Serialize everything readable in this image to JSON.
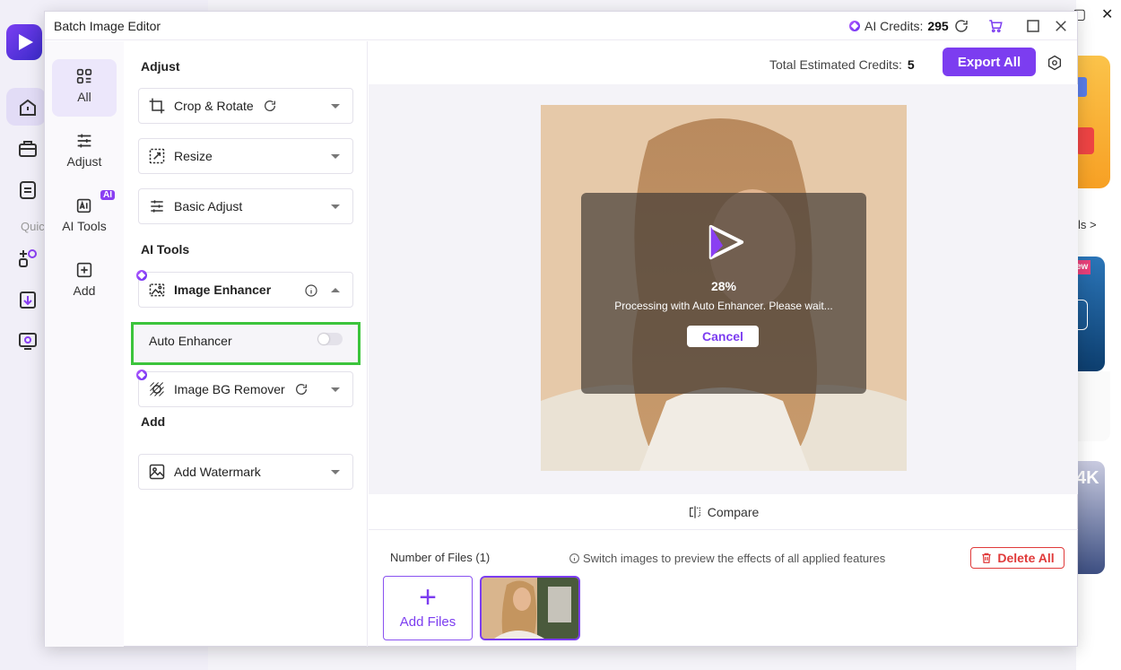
{
  "background": {
    "rail_quick_label": "Quic",
    "right_text": "ls >",
    "right_badge": "ew",
    "right_4k": "4K"
  },
  "dialog": {
    "title": "Batch Image Editor",
    "ai_credits_label": "AI Credits:",
    "ai_credits_value": "295",
    "icons": [
      "refresh-icon",
      "cart-icon",
      "maximize-icon",
      "close-icon"
    ]
  },
  "rail": {
    "items": [
      {
        "label": "All",
        "icon": "grid-icon",
        "active": true
      },
      {
        "label": "Adjust",
        "icon": "sliders-icon",
        "active": false
      },
      {
        "label": "AI Tools",
        "icon": "ai-icon",
        "active": false,
        "badge": "AI"
      },
      {
        "label": "Add",
        "icon": "plus-square-icon",
        "active": false
      }
    ]
  },
  "panel": {
    "adjust_title": "Adjust",
    "crop_rotate": "Crop & Rotate",
    "resize": "Resize",
    "basic_adjust": "Basic Adjust",
    "ai_tools_title": "AI Tools",
    "image_enhancer": "Image Enhancer",
    "auto_enhancer": "Auto Enhancer",
    "auto_enhancer_on": false,
    "bg_remover": "Image BG Remover",
    "add_title": "Add",
    "add_watermark": "Add Watermark"
  },
  "main": {
    "estimated_label": "Total Estimated Credits:",
    "estimated_value": "5",
    "export_label": "Export All",
    "progress_percent": "28%",
    "processing_message": "Processing with Auto Enhancer. Please wait...",
    "cancel_label": "Cancel",
    "compare_label": "Compare",
    "files_count": "Number of Files (1)",
    "hint": "Switch images to preview the effects of all applied features",
    "delete_label": "Delete All",
    "add_files_label": "Add Files"
  },
  "colors": {
    "accent": "#7c3df0",
    "danger": "#e03a3a",
    "highlight": "#3cc43c"
  }
}
